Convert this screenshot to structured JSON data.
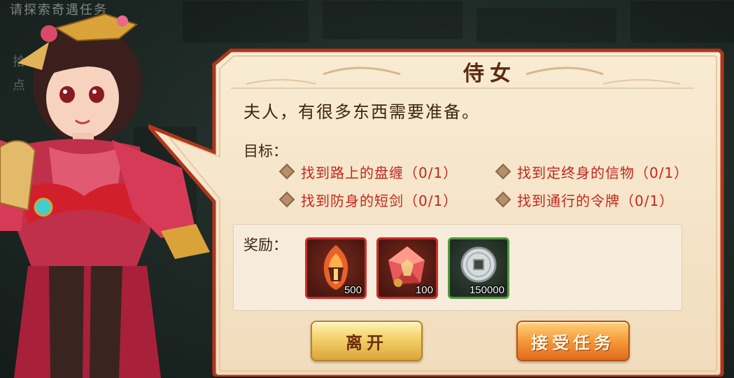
{
  "background": {
    "top_hint": "请探索奇遇任务",
    "side_hint": [
      "拾",
      "点"
    ]
  },
  "dialog": {
    "npc_name": "侍女",
    "text": "夫人，有很多东西需要准备。",
    "goal_label": "目标：",
    "objectives": [
      {
        "text": "找到路上的盘缠（0/1）"
      },
      {
        "text": "找到定终身的信物（0/1）"
      },
      {
        "text": "找到防身的短剑（0/1）"
      },
      {
        "text": "找到通行的令牌（0/1）"
      }
    ],
    "reward_label": "奖励：",
    "rewards": [
      {
        "icon": "fire-helmet-icon",
        "quantity": "500",
        "rarity_color": "#c9302a"
      },
      {
        "icon": "red-gem-icon",
        "quantity": "100",
        "rarity_color": "#c9302a"
      },
      {
        "icon": "silver-coin-icon",
        "quantity": "150000",
        "rarity_color": "#4e9a3a"
      }
    ],
    "buttons": {
      "leave": "离开",
      "accept": "接受任务"
    }
  }
}
